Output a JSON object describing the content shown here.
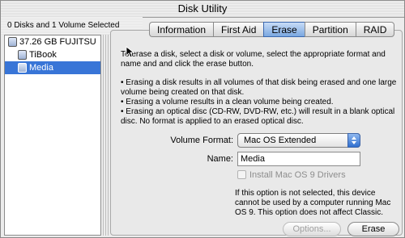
{
  "window": {
    "title": "Disk Utility"
  },
  "status": "0 Disks and 1 Volume Selected",
  "disks": [
    {
      "label": "37.26 GB FUJITSU",
      "level": 1,
      "selected": false
    },
    {
      "label": "TiBook",
      "level": 2,
      "selected": false
    },
    {
      "label": "Media",
      "level": 2,
      "selected": true
    }
  ],
  "tabs": [
    {
      "label": "Information",
      "active": false
    },
    {
      "label": "First Aid",
      "active": false
    },
    {
      "label": "Erase",
      "active": true
    },
    {
      "label": "Partition",
      "active": false
    },
    {
      "label": "RAID",
      "active": false
    }
  ],
  "erase": {
    "intro": "To erase a disk, select a disk or volume, select the appropriate format and name and and click the erase button.",
    "bullets": [
      "• Erasing a disk results in all volumes of that disk being erased and one large volume being created on that disk.",
      "• Erasing a volume results in a clean volume being created.",
      "• Erasing an optical disc (CD-RW, DVD-RW, etc.) will result in a blank optical disc. No format is applied to an erased optical disc."
    ],
    "format_label": "Volume Format:",
    "format_value": "Mac OS Extended",
    "name_label": "Name:",
    "name_value": "Media",
    "checkbox_label": "Install Mac OS 9 Drivers",
    "note": "If this option is not selected, this device cannot be used by a computer running Mac OS 9.  This option does not affect Classic.",
    "options_button": "Options...",
    "erase_button": "Erase"
  },
  "colors": {
    "selection": "#3875d7",
    "active_tab": "#7aa7e0"
  }
}
